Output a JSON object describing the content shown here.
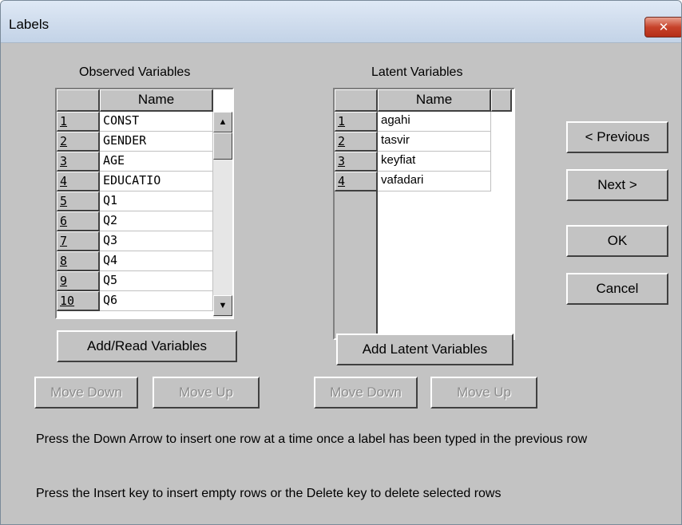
{
  "window": {
    "title": "Labels",
    "close_glyph": "✕"
  },
  "observed": {
    "title": "Observed Variables",
    "column_header": "Name",
    "rows": [
      {
        "num": "1",
        "name": "CONST"
      },
      {
        "num": "2",
        "name": "GENDER"
      },
      {
        "num": "3",
        "name": "AGE"
      },
      {
        "num": "4",
        "name": "EDUCATIO"
      },
      {
        "num": "5",
        "name": "Q1"
      },
      {
        "num": "6",
        "name": "Q2"
      },
      {
        "num": "7",
        "name": "Q3"
      },
      {
        "num": "8",
        "name": "Q4"
      },
      {
        "num": "9",
        "name": "Q5"
      },
      {
        "num": "10",
        "name": "Q6"
      }
    ],
    "add_button": "Add/Read Variables",
    "move_down": "Move Down",
    "move_up": "Move Up"
  },
  "latent": {
    "title": "Latent Variables",
    "column_header": "Name",
    "rows": [
      {
        "num": "1",
        "name": "agahi"
      },
      {
        "num": "2",
        "name": "tasvir"
      },
      {
        "num": "3",
        "name": "keyfiat"
      },
      {
        "num": "4",
        "name": "vafadari"
      }
    ],
    "add_button": "Add Latent Variables",
    "move_down": "Move Down",
    "move_up": "Move Up"
  },
  "nav": {
    "previous": "< Previous",
    "next": "Next >",
    "ok": "OK",
    "cancel": "Cancel"
  },
  "instructions": {
    "line1": "Press the Down Arrow to insert one row at a time once a label has been typed in the previous row",
    "line2": "Press the Insert key to insert empty rows or the Delete key to delete selected rows"
  },
  "scroll": {
    "up_glyph": "▲",
    "down_glyph": "▼"
  },
  "colors": {
    "dialog_bg": "#c3c3c3",
    "titlebar": "#cfdced",
    "close": "#c7432b"
  }
}
